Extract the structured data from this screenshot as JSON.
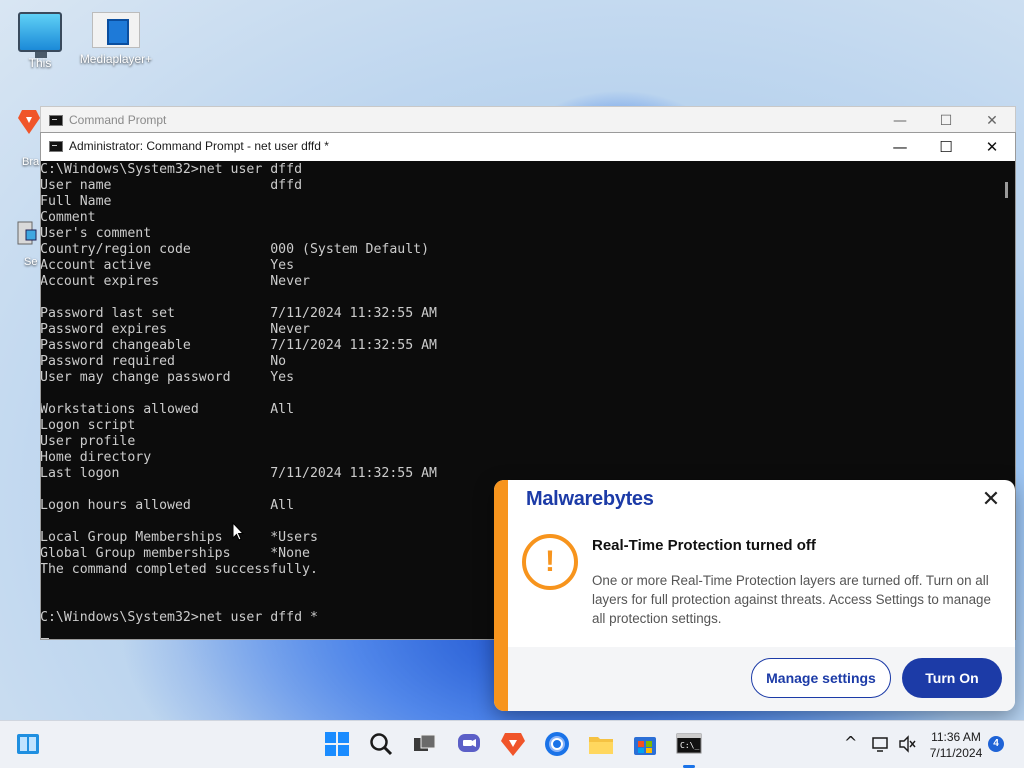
{
  "desktop": {
    "icons": [
      {
        "label": "This",
        "icon": "this-pc-icon"
      },
      {
        "label": "Mediaplayer+",
        "icon": "media-player-icon"
      }
    ],
    "partial_icons": [
      {
        "label": "Bra",
        "icon": "brave-browser-icon"
      },
      {
        "label": "Se",
        "icon": "setup-icon"
      }
    ]
  },
  "back_window": {
    "title": "Command Prompt",
    "controls": {
      "minimize": "—",
      "maximize": "☐",
      "close": "✕"
    }
  },
  "front_window": {
    "title": "Administrator: Command Prompt - net  user dffd *",
    "controls": {
      "minimize": "—",
      "maximize": "☐",
      "close": "✕"
    },
    "console_lines": [
      "C:\\Windows\\System32>net user dffd",
      "User name                    dffd",
      "Full Name",
      "Comment",
      "User's comment",
      "Country/region code          000 (System Default)",
      "Account active               Yes",
      "Account expires              Never",
      "",
      "Password last set            7/11/2024 11:32:55 AM",
      "Password expires             Never",
      "Password changeable          7/11/2024 11:32:55 AM",
      "Password required            No",
      "User may change password     Yes",
      "",
      "Workstations allowed         All",
      "Logon script",
      "User profile",
      "Home directory",
      "Last logon                   7/11/2024 11:32:55 AM",
      "",
      "Logon hours allowed          All",
      "",
      "Local Group Memberships      *Users",
      "Global Group memberships     *None",
      "The command completed successfully.",
      "",
      "",
      "C:\\Windows\\System32>net user dffd *"
    ]
  },
  "notification": {
    "brand": "Malwarebytes",
    "close": "✕",
    "headline": "Real-Time Protection turned off",
    "body": "One or more Real-Time Protection layers are turned off. Turn on all layers for full protection against threats. Access Settings to manage all protection settings.",
    "warning_glyph": "!",
    "buttons": {
      "secondary": "Manage settings",
      "primary": "Turn On"
    },
    "colors": {
      "accent": "#f7941d",
      "brand": "#1c3ba7"
    }
  },
  "taskbar": {
    "items": [
      "widgets-icon",
      "start-icon",
      "search-icon",
      "task-view-icon",
      "chat-icon",
      "brave-icon",
      "chrome-icon",
      "file-explorer-icon",
      "store-icon",
      "terminal-icon"
    ],
    "tray": {
      "chevron": "^",
      "time": "11:36 AM",
      "date": "7/11/2024",
      "notification_count": "4"
    }
  }
}
